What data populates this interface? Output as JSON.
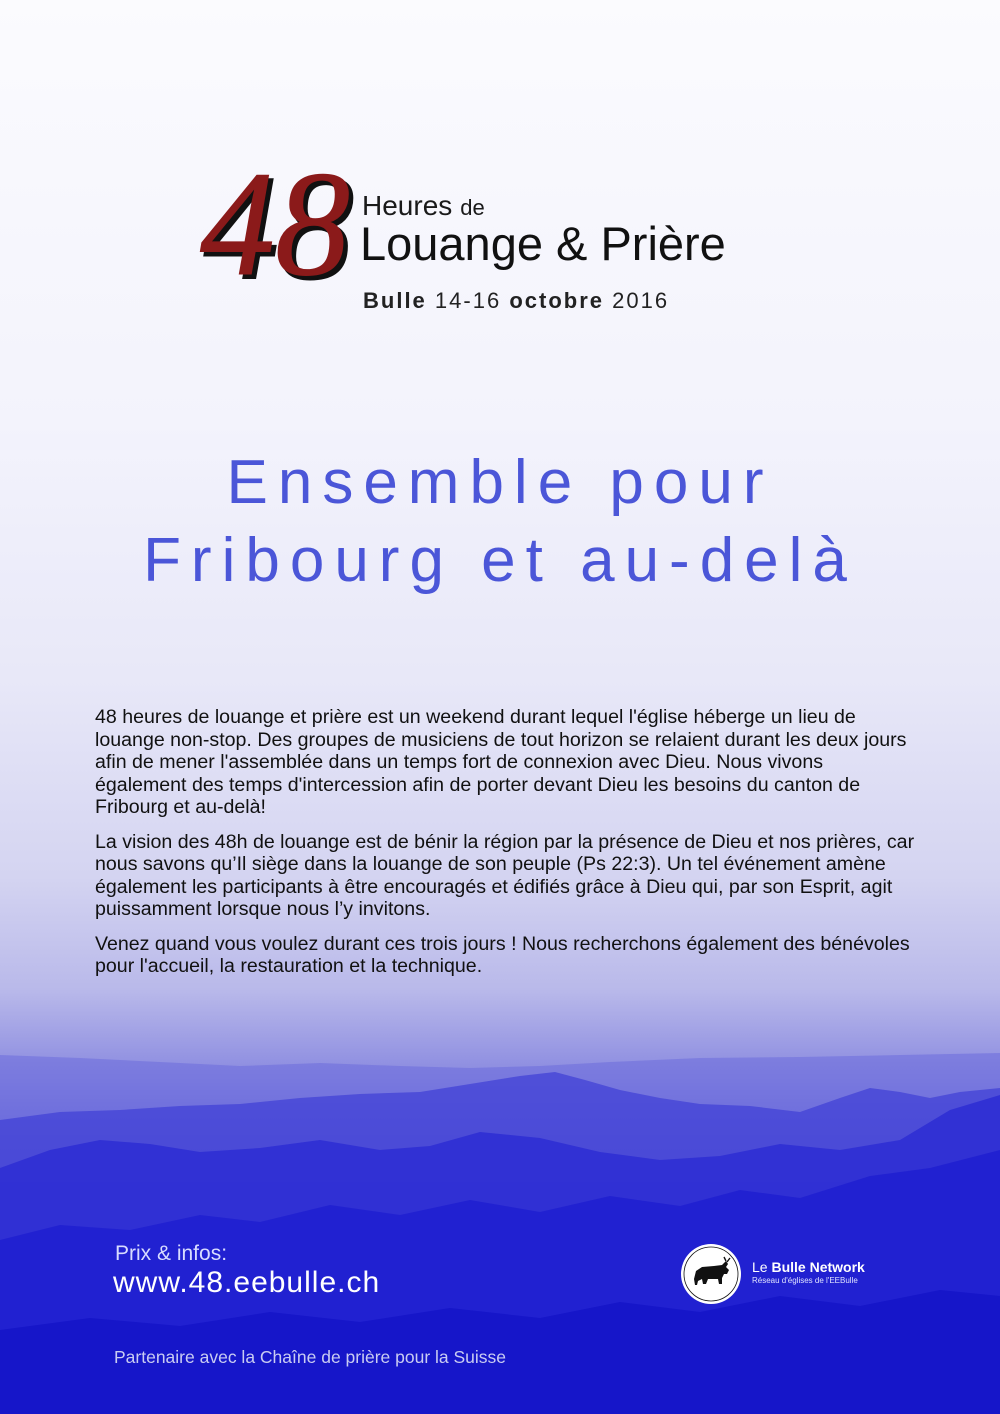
{
  "header": {
    "logo_number": "48",
    "heures": "Heures",
    "de": "de",
    "title": "Louange & Prière",
    "date": {
      "place": "Bulle",
      "days": "14-16",
      "month": "octobre",
      "year": "2016"
    }
  },
  "tagline": {
    "line1": "Ensemble pour",
    "line2": "Fribourg et au-delà"
  },
  "body": {
    "paragraphs": [
      "48 heures de louange et prière est un weekend durant lequel l'église héberge un lieu de louange non-stop. Des groupes de musiciens de tout horizon se relaient durant les deux jours afin de mener l'assemblée dans un temps fort de connexion avec Dieu. Nous vivons également des temps d'intercession afin de porter devant Dieu les besoins du canton de Fribourg et au-delà!",
      "La vision des 48h de louange est de bénir la région par la présence de Dieu et nos prières, car nous savons qu’Il siège dans la louange de son peuple (Ps 22:3). Un tel événement amène également les participants à être encouragés et édifiés grâce à Dieu qui, par son Esprit, agit puissamment lorsque nous l’y invitons.",
      "Venez quand vous voulez durant ces trois jours ! Nous recherchons également des bénévoles pour l'accueil, la restauration et la technique."
    ]
  },
  "footer": {
    "prix_label": "Prix & infos:",
    "website": "www.48.eebulle.ch",
    "partner": "Partenaire avec la Chaîne de prière pour la Suisse",
    "network": {
      "name_prefix": "Le",
      "name_bold": "Bulle Network",
      "subtitle": "Réseau d'églises de l'EEBulle",
      "emblem_icon": "bull-icon"
    }
  },
  "colors": {
    "logo_red": "#8b1a1a",
    "tagline_blue": "#4b56d8",
    "landscape_blue": "#1a1ad0"
  }
}
